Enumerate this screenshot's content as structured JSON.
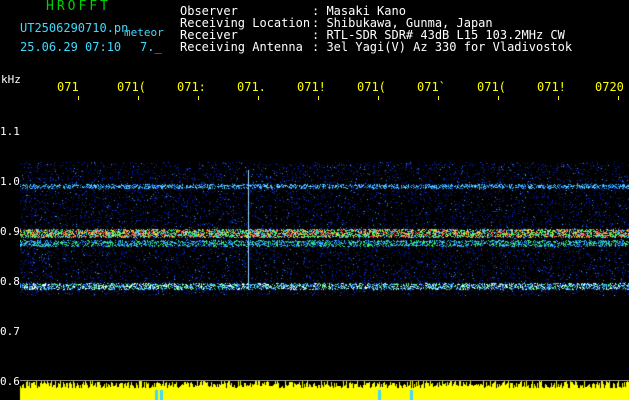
{
  "header": {
    "brand": "HROFFT",
    "filename": "UT2506290710.pn",
    "suffix": "meteor",
    "datetime": "25.06.29 07:10",
    "counter": "7._",
    "fields": [
      {
        "label": "Observer",
        "value": ": Masaki Kano"
      },
      {
        "label": "Receiving Location",
        "value": ": Shibukawa, Gunma, Japan"
      },
      {
        "label": "Receiver",
        "value": ": RTL-SDR SDR# 43dB L15 103.2MHz CW"
      },
      {
        "label": "Receiving Antenna",
        "value": ": 3el Yagi(V) Az 330 for Vladivostok"
      }
    ]
  },
  "axis": {
    "unit": "kHz",
    "y_ticks": [
      "1.1",
      "1.0",
      "0.9",
      "0.8",
      "0.7",
      "0.6"
    ],
    "x_ticks": [
      "071",
      "071(",
      "071:",
      "071.",
      "071!",
      "071(",
      "071`",
      "071(",
      "071!",
      "0720"
    ]
  },
  "colors": {
    "background": "#000000",
    "header_text": "#ffffff",
    "brand": "#00d000",
    "axis_labels": "#ffff00",
    "info_text": "#40d8ff",
    "level_bars": "#ffff00"
  }
}
